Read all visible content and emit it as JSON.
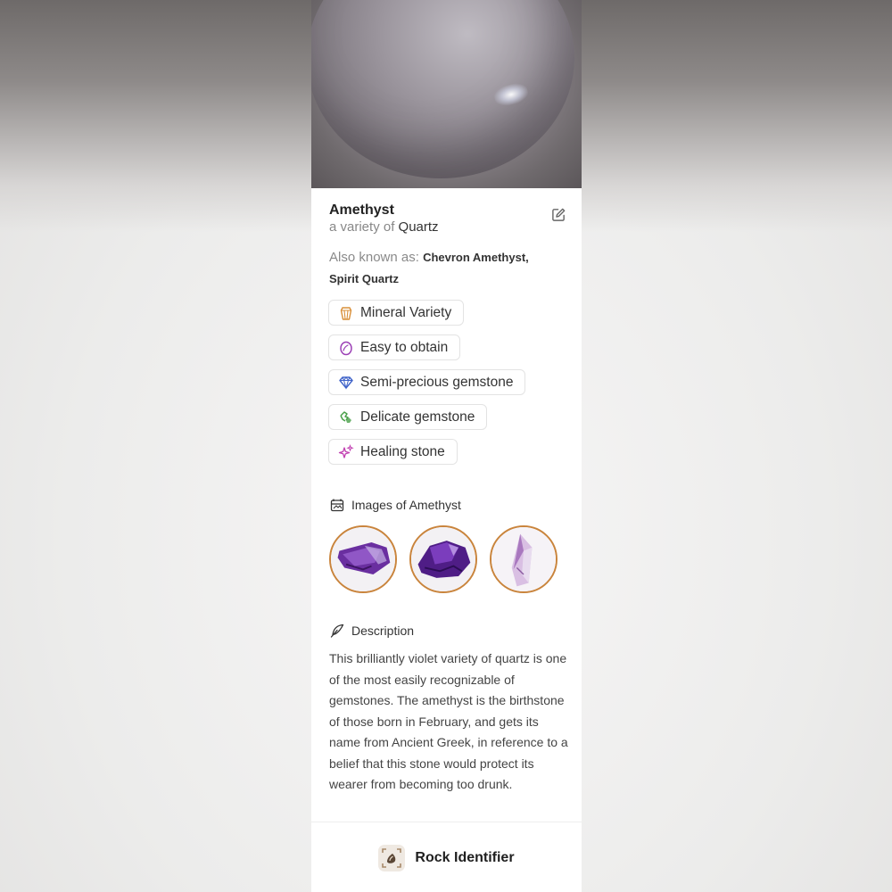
{
  "rock": {
    "name": "Amethyst",
    "variety_prefix": "a variety of",
    "variety": "Quartz",
    "aka_label": "Also known as:",
    "aka_names": "Chevron Amethyst, Spirit Quartz"
  },
  "tags": [
    {
      "label": "Mineral Variety",
      "icon": "crystal-icon",
      "color": "#d9903a"
    },
    {
      "label": "Easy to obtain",
      "icon": "gem-egg-icon",
      "color": "#9b3fb5"
    },
    {
      "label": "Semi-precious gemstone",
      "icon": "diamond-icon",
      "color": "#3f63c9"
    },
    {
      "label": "Delicate gemstone",
      "icon": "broken-gem-icon",
      "color": "#4aa04a"
    },
    {
      "label": "Healing stone",
      "icon": "sparkle-icon",
      "color": "#c13fb1"
    }
  ],
  "images_section": {
    "title": "Images of Amethyst",
    "icon": "gallery-icon"
  },
  "description_section": {
    "title": "Description",
    "icon": "quill-icon",
    "text": "This brilliantly violet variety of quartz is one of the most easily recognizable of gemstones. The amethyst is the birthstone of those born in February, and gets its name from Ancient Greek, in reference to a belief that this stone would protect its wearer from becoming too drunk."
  },
  "footer": {
    "app_name": "Rock Identifier",
    "icon": "rock-identifier-app-icon"
  },
  "colors": {
    "accent_ring": "#c9843c",
    "text_primary": "#222222",
    "text_secondary": "#888888"
  }
}
